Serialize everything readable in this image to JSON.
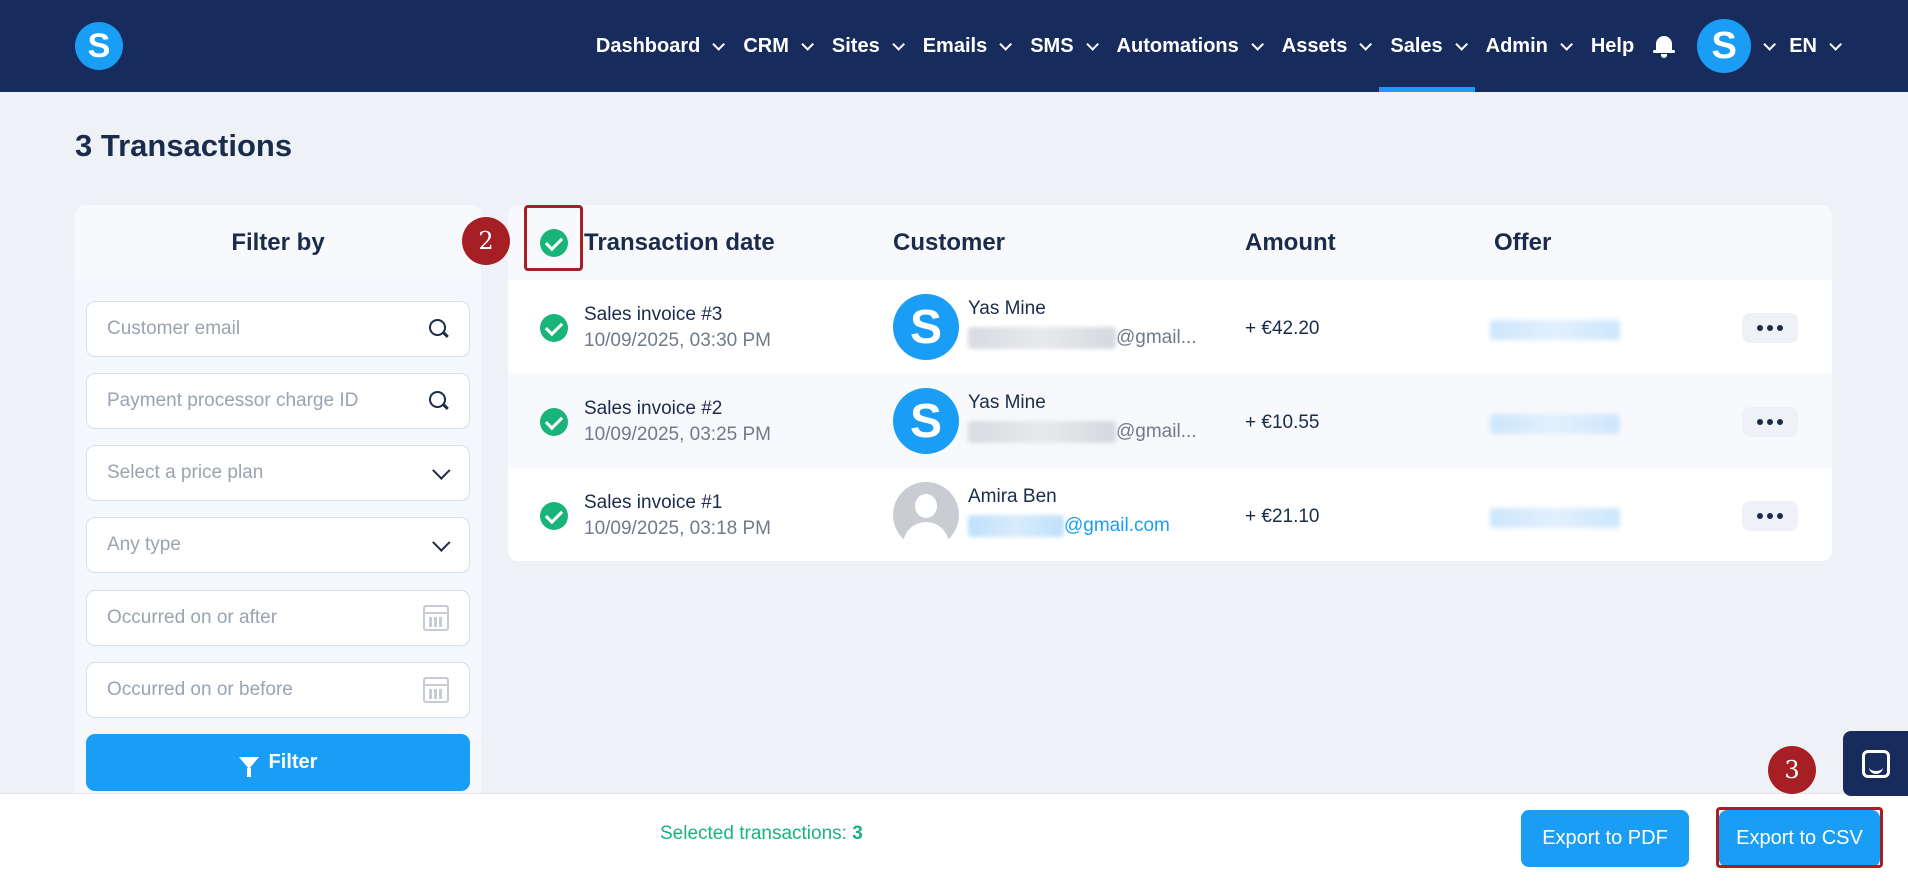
{
  "nav": {
    "logo_letter": "S",
    "items": [
      {
        "label": "Dashboard",
        "has_dropdown": true
      },
      {
        "label": "CRM",
        "has_dropdown": true
      },
      {
        "label": "Sites",
        "has_dropdown": true
      },
      {
        "label": "Emails",
        "has_dropdown": true
      },
      {
        "label": "SMS",
        "has_dropdown": true
      },
      {
        "label": "Automations",
        "has_dropdown": true
      },
      {
        "label": "Assets",
        "has_dropdown": true
      },
      {
        "label": "Sales",
        "has_dropdown": true,
        "active": true
      },
      {
        "label": "Admin",
        "has_dropdown": true
      },
      {
        "label": "Help",
        "has_dropdown": false
      }
    ],
    "avatar_letter": "S",
    "language": "EN"
  },
  "page": {
    "title": "3 Transactions"
  },
  "filter": {
    "heading": "Filter by",
    "customer_email_placeholder": "Customer email",
    "charge_id_placeholder": "Payment processor charge ID",
    "price_plan_placeholder": "Select a price plan",
    "type_value": "Any type",
    "after_placeholder": "Occurred on or after",
    "before_placeholder": "Occurred on or before",
    "button_label": "Filter"
  },
  "table": {
    "columns": [
      "Transaction date",
      "Customer",
      "Amount",
      "Offer"
    ],
    "rows": [
      {
        "title": "Sales invoice #3",
        "date": "10/09/2025, 03:30 PM",
        "customer_name": "Yas Mine",
        "email_suffix": "@gmail...",
        "amount": "+ €42.20",
        "selected": true
      },
      {
        "title": "Sales invoice #2",
        "date": "10/09/2025, 03:25 PM",
        "customer_name": "Yas Mine",
        "email_suffix": "@gmail...",
        "amount": "+ €10.55",
        "selected": true
      },
      {
        "title": "Sales invoice #1",
        "date": "10/09/2025, 03:18 PM",
        "customer_name": "Amira Ben",
        "email_suffix": "@gmail.com",
        "amount": "+ €21.10",
        "selected": true
      }
    ]
  },
  "annotations": {
    "step_2": "2",
    "step_3": "3"
  },
  "bottom": {
    "selected_label": "Selected transactions: ",
    "selected_count": "3",
    "export_pdf": "Export to PDF",
    "export_csv": "Export to CSV"
  },
  "colors": {
    "nav_bg": "#172b5c",
    "accent": "#1a9df5",
    "success": "#19b47a",
    "annotation": "#a51f24"
  }
}
